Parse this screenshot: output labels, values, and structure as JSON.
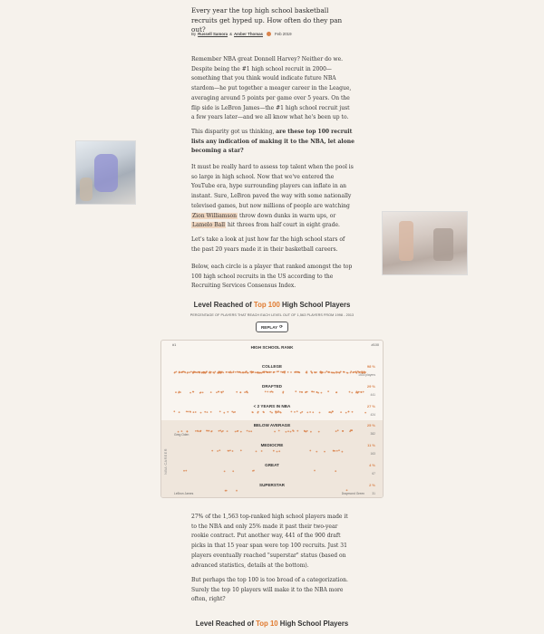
{
  "lead": "Every year the top high school basketball recruits get hyped up. How often do they pan out?",
  "byline": {
    "by": "By",
    "author1": "Russell Samora",
    "and": "&",
    "author2": "Amber Thomas",
    "date": "Feb 2019"
  },
  "paragraphs": {
    "p1": "Remember NBA great Donnell Harvey? Neither do we. Despite being the #1 high school recruit in 2000—something that you think would indicate future NBA stardom—he put together a meager career in the League, averaging around 5 points per game over 5 years. On the flip side is LeBron James—the #1 high school recruit just a few years later—and we all know what he's been up to.",
    "p2a": "This disparity got us thinking, ",
    "p2b": "are these top 100 recruit lists any indication of making it to the NBA, let alone becoming a star?",
    "p3a": "It must be really hard to assess top talent when the pool is so large in high school. Now that we've entered the YouTube era, hype surrounding players can inflate in an instant. Sure, LeBron paved the way with some nationally televised games, but now millions of people are watching ",
    "p3b": "Zion Williamson",
    "p3c": " throw down dunks in warm ups, or ",
    "p3d": "Lamelo Ball",
    "p3e": " hit threes from half court in eight grade.",
    "p4": "Let's take a look at just how far the high school stars of the past 20 years made it in their basketball careers.",
    "p5": "Below, each circle is a player that ranked amongst the top 100 high school recruits in the US according to the Recruiting Services Consensus Index.",
    "p6": "27% of the 1,563 top-ranked high school players made it to the NBA and only 25% made it past their two-year rookie contract. Put another way, 441 of the 900 draft picks in that 15 year span were top 100 recruits. Just 31 players eventually reached \"superstar\" status (based on advanced statistics, details at the bottom).",
    "p7": "But perhaps the top 100 is too broad of a categorization. Surely the top 10 players will make it to the NBA more often, right?"
  },
  "chart1": {
    "title_pre": "Level Reached of ",
    "title_hl": "Top 100",
    "title_post": " High School Players",
    "subtitle": "PERCENTAGE OF PLAYERS THAT REACH EACH LEVEL OUT OF 1,563 PLAYERS FROM 1998 - 2013",
    "replay": "REPLAY",
    "rank_start": "#1",
    "rank_end": "#100",
    "nba_career": "NBA CAREER",
    "rows": [
      {
        "label": "HIGH SCHOOL RANK",
        "pct": "",
        "count": ""
      },
      {
        "label": "COLLEGE",
        "pct": "98 %",
        "count": "1533 players"
      },
      {
        "label": "DRAFTED",
        "pct": "29 %",
        "count": "441"
      },
      {
        "label": "< 2 YEARS IN NBA",
        "pct": "27 %",
        "count": "424"
      },
      {
        "label": "BELOW AVERAGE",
        "pct": "25 %",
        "count": "382"
      },
      {
        "label": "MEDIOCRE",
        "pct": "11 %",
        "count": "163"
      },
      {
        "label": "GREAT",
        "pct": "4 %",
        "count": "67"
      },
      {
        "label": "SUPERSTAR",
        "pct": "2 %",
        "count": "31"
      }
    ],
    "examples": {
      "below_average": "Greg Oden",
      "superstar_left": "LeBron James",
      "superstar_right": "Draymond Green"
    },
    "colors": {
      "accent": "#e07a2f",
      "dot": "#d9824b"
    }
  },
  "chart2": {
    "title_pre": "Level Reached of ",
    "title_hl": "Top 10",
    "title_post": " High School Players"
  }
}
